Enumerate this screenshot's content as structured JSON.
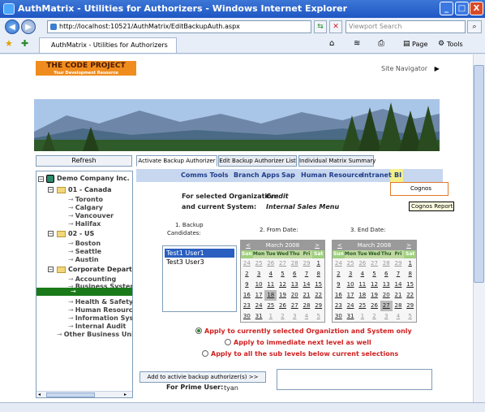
{
  "window": {
    "title": "AuthMatrix - Utilities for Authorizers - Windows Internet Explorer",
    "min": "_",
    "max": "□",
    "close": "X"
  },
  "browser": {
    "url": "http://localhost:10521/AuthMatrix/EditBackupAuth.aspx",
    "search_placeholder": "Viewport Search",
    "tab_title": "AuthMatrix - Utilities for Authorizers",
    "page_label": "Page",
    "tools_label": "Tools"
  },
  "page": {
    "logo_text": "THE CODE PROJECT",
    "logo_sub": "Your Development Resource",
    "site_navigator": "Site Navigator",
    "refresh": "Refresh",
    "tabs": [
      "Activate Backup Authorizer",
      "Edit Backup Authorizer List",
      "Individual Matrix Summary"
    ],
    "menu": [
      "Comms Tools",
      "Branch Apps",
      "Sap",
      "Human Resource",
      "Intranet",
      "BI"
    ],
    "dropdown_item": "Cognos",
    "tooltip": "Cognos Report",
    "org_label": "For selected Organization:",
    "org_value": "Credit",
    "system_label": "and current System:",
    "system_value": "Internal Sales Menu",
    "backup_label_1": "1. Backup",
    "backup_label_2": "Candidates:",
    "from_label": "2. From Date:",
    "end_label": "3. End Date:",
    "candidates": [
      "Test1 User1",
      "Test3 User3"
    ],
    "radio_options": [
      "Apply to currently selected Organiztion and System only",
      "Apply to immediate next level as well",
      "Apply to all the sub levels below current selections"
    ],
    "add_button": "Add to activie backup authorizer(s) >>",
    "prime_user_label": "For Prime User:",
    "prime_user_value": "tyan"
  },
  "tree": {
    "root": "Demo Company Inc.",
    "nodes": [
      {
        "label": "01 - Canada",
        "children": [
          "Toronto",
          "Calgary",
          "Vancouver",
          "Halifax"
        ]
      },
      {
        "label": "02 - US",
        "children": [
          "Boston",
          "Seattle",
          "Austin"
        ]
      },
      {
        "label": "Corporate Departmen",
        "children": [
          "Accounting",
          "Business Systems",
          "",
          "Health & Safety",
          "Human Resources",
          "Information Syster",
          "Internal Audit"
        ]
      }
    ],
    "other": "Other Business Units"
  },
  "calendar": {
    "month": "March 2008",
    "prev": "<",
    "next": ">",
    "days": [
      "Sun",
      "Mon",
      "Tue",
      "Wed",
      "Thu",
      "Fri",
      "Sat"
    ],
    "weeks": [
      [
        "24",
        "25",
        "26",
        "27",
        "28",
        "29",
        "1"
      ],
      [
        "2",
        "3",
        "4",
        "5",
        "6",
        "7",
        "8"
      ],
      [
        "9",
        "10",
        "11",
        "12",
        "13",
        "14",
        "15"
      ],
      [
        "16",
        "17",
        "18",
        "19",
        "20",
        "21",
        "22"
      ],
      [
        "23",
        "24",
        "25",
        "26",
        "27",
        "28",
        "29"
      ],
      [
        "30",
        "31",
        "1",
        "2",
        "3",
        "4",
        "5"
      ]
    ],
    "from_today": "18",
    "end_today": "27"
  }
}
